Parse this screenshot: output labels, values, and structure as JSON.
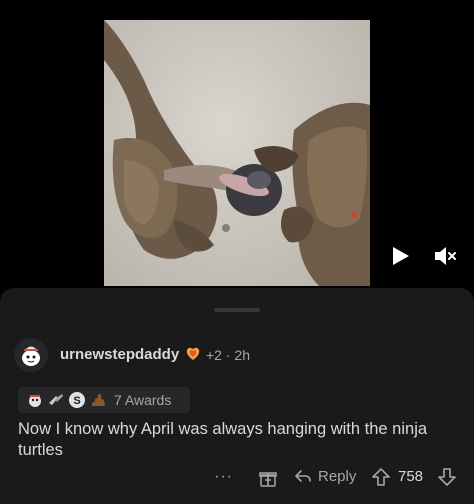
{
  "video": {
    "description_icon": "video-player",
    "play_icon": "play-icon",
    "mute_icon": "muted-speaker-icon"
  },
  "comment": {
    "username": "urnewstepdaddy",
    "flair_icon": "flame-heart-flair-icon",
    "meta": "+2 · 2h",
    "awards_label": "7 Awards",
    "award_icons": [
      "gold-crab-award-icon",
      "crossed-hands-award-icon",
      "silver-s-award-icon",
      "poop-award-icon"
    ],
    "body": "Now I know why April was always hanging with the ninja turtles",
    "actions": {
      "more_label": "···",
      "reply_label": "Reply",
      "score": "758"
    }
  },
  "colors": {
    "background": "#000000",
    "sheet": "#1a1a1b",
    "text_primary": "#d7dadc",
    "text_secondary": "#a4a7a9"
  }
}
